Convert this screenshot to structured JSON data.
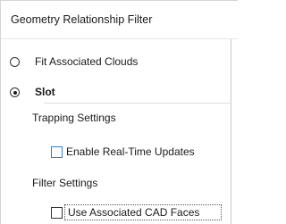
{
  "panel": {
    "title": "Geometry Relationship Filter"
  },
  "options": {
    "fit_associated_clouds": {
      "label": "Fit Associated Clouds",
      "selected": false
    },
    "slot": {
      "label": "Slot",
      "selected": true
    }
  },
  "trapping_settings": {
    "label": "Trapping Settings",
    "enable_realtime_updates": {
      "label": "Enable Real-Time Updates",
      "checked": false
    }
  },
  "filter_settings": {
    "label": "Filter Settings",
    "use_associated_cad_faces": {
      "label": "Use Associated CAD Faces",
      "checked": false
    }
  }
}
